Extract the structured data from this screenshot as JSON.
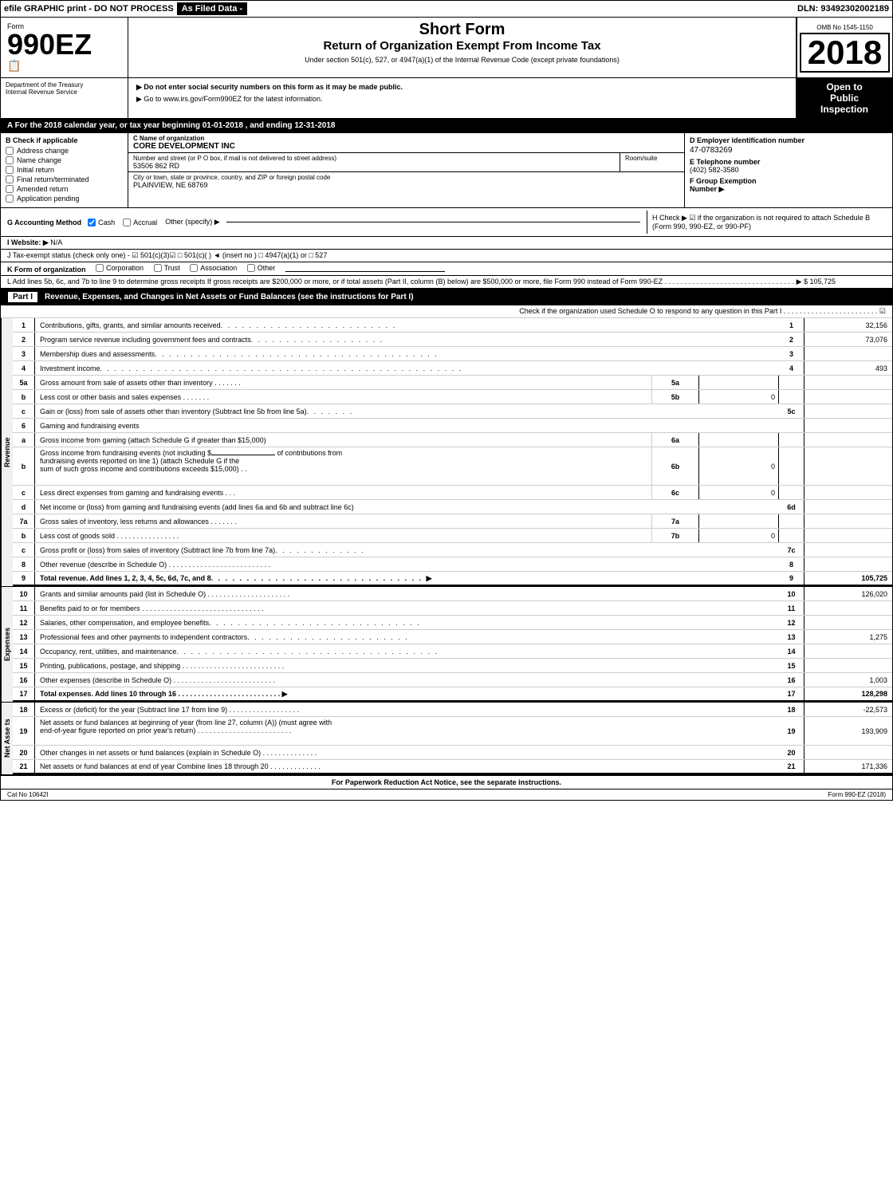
{
  "topbar": {
    "text": "efile GRAPHIC print - DO NOT PROCESS",
    "filed": "As Filed Data -",
    "dln": "DLN: 93492302002189"
  },
  "form": {
    "form_label": "Form",
    "form_number": "990EZ",
    "short_form": "Short Form",
    "return_title": "Return of Organization Exempt From Income Tax",
    "subtitle": "Under section 501(c), 527, or 4947(a)(1) of the Internal Revenue Code (except private foundations)",
    "omb": "OMB No 1545-1150",
    "year": "2018",
    "open_to": "Open to",
    "public": "Public",
    "inspection": "Inspection"
  },
  "notices": {
    "notice1": "▶ Do not enter social security numbers on this form as it may be made public.",
    "notice2": "▶ Go to www.irs.gov/Form990EZ for the latest information."
  },
  "tax_year": {
    "text": "A  For the 2018 calendar year, or tax year beginning 01-01-2018      , and ending 12-31-2018"
  },
  "check_applicable": {
    "label": "B  Check if applicable",
    "items": [
      "Address change",
      "Name change",
      "Initial return",
      "Final return/terminated",
      "Amended return",
      "Application pending"
    ]
  },
  "org": {
    "name_label": "C Name of organization",
    "name": "CORE DEVELOPMENT INC",
    "address_label": "Number and street (or P O box, if mail is not delivered to street address)",
    "address": "53506 862 RD",
    "room_label": "Room/suite",
    "city_label": "City or town, state or province, country, and ZIP or foreign postal code",
    "city": "PLAINVIEW, NE  68769"
  },
  "ein": {
    "label": "D Employer identification number",
    "value": "47-0783269",
    "phone_label": "E Telephone number",
    "phone": "(402) 582-3580",
    "group_label": "F Group Exemption",
    "group_sub": "Number  ▶"
  },
  "accounting": {
    "label": "G Accounting Method",
    "cash": "Cash",
    "accrual": "Accrual",
    "other": "Other (specify) ▶",
    "h_check": "H  Check ▶",
    "h_text": "☑ if the organization is not required to attach Schedule B (Form 990, 990-EZ, or 990-PF)"
  },
  "website": {
    "label": "I Website: ▶",
    "value": "N/A"
  },
  "tax_status": {
    "text": "J Tax-exempt status (check only one) - ☑ 501(c)(3)☑ □ 501(c)(  ) ◄ (insert no ) □ 4947(a)(1) or □ 527"
  },
  "form_org": {
    "label": "K Form of organization",
    "corporation": "Corporation",
    "trust": "Trust",
    "association": "Association",
    "other": "Other"
  },
  "add_lines": {
    "text": "L Add lines 5b, 6c, and 7b to line 9 to determine gross receipts  If gross receipts are $200,000 or more, or if total assets (Part II, column (B) below) are $500,000 or more, file Form 990 instead of Form 990-EZ . . . . . . . . . . . . . . . . . . . . . . . . . . . . . . . . . ▶ $ 105,725"
  },
  "part1": {
    "label": "Part I",
    "title": "Revenue, Expenses, and Changes in Net Assets or Fund Balances (see the instructions for Part I)",
    "schedule_o": "Check if the organization used Schedule O to respond to any question in this Part I . . . . . . . . . . . . . . . . . . . . . . . . ☑",
    "rows": [
      {
        "num": "1",
        "desc": "Contributions, gifts, grants, and similar amounts received . . . . . . . . . . . . . . . . . . . . . . . . . .",
        "main_num": "1",
        "main_val": "32,156",
        "sub_num": "",
        "sub_val": ""
      },
      {
        "num": "2",
        "desc": "Program service revenue including government fees and contracts . . . . . . . . . . . . . . . . . . .",
        "main_num": "2",
        "main_val": "73,076",
        "sub_num": "",
        "sub_val": ""
      },
      {
        "num": "3",
        "desc": "Membership dues and assessments . . . . . . . . . . . . . . . . . . . . . . . . . . . . . . . . . . . . . . . .",
        "main_num": "3",
        "main_val": "",
        "sub_num": "",
        "sub_val": ""
      },
      {
        "num": "4",
        "desc": "Investment income . . . . . . . . . . . . . . . . . . . . . . . . . . . . . . . . . . . . . . . . . . . . . . . . . . . .",
        "main_num": "4",
        "main_val": "493",
        "sub_num": "",
        "sub_val": ""
      },
      {
        "num": "5a",
        "desc": "Gross amount from sale of assets other than inventory  . . . . . . .",
        "main_num": "",
        "main_val": "",
        "sub_num": "5a",
        "sub_val": ""
      },
      {
        "num": "b",
        "desc": "Less  cost or other basis and sales expenses . . . . . . . .",
        "main_num": "",
        "main_val": "",
        "sub_num": "5b",
        "sub_val": "0"
      },
      {
        "num": "c",
        "desc": "Gain or (loss) from sale of assets other than inventory (Subtract line 5b from line 5a) . . . . . . . .",
        "main_num": "5c",
        "main_val": "",
        "sub_num": "",
        "sub_val": ""
      }
    ],
    "gaming_label": "6    Gaming and fundraising events",
    "row6a": {
      "num": "a",
      "desc": "Gross income from gaming (attach Schedule G if greater than $15,000)",
      "sub_num": "6a",
      "sub_val": ""
    },
    "row6b_prefix": "b    Gross income from fundraising events (not including $",
    "row6b_suffix": "of contributions from",
    "row6b_line2": "fundraising events reported on line 1) (attach Schedule G if the",
    "row6b_line3": "sum of such gross income and contributions exceeds $15,000)",
    "row6b": {
      "sub_num": "6b",
      "sub_val": "0"
    },
    "row6c": {
      "num": "c",
      "desc": "Less  direct expenses from gaming and fundraising events   .  .  .",
      "sub_num": "6c",
      "sub_val": "0"
    },
    "row6d": {
      "num": "d",
      "desc": "Net income or (loss) from gaming and fundraising events (add lines 6a and 6b and subtract line 6c)",
      "main_num": "6d",
      "main_val": ""
    },
    "row7a": {
      "num": "7a",
      "desc": "Gross sales of inventory, less returns and allowances . . . . . . . .",
      "sub_num": "7a",
      "sub_val": ""
    },
    "row7b": {
      "num": "b",
      "desc": "Less  cost of goods sold        .  .  .  .  .  .  .  .  .  .  .  .  .  .  .  .",
      "sub_num": "7b",
      "sub_val": "0"
    },
    "row7c": {
      "num": "c",
      "desc": "Gross profit or (loss) from sales of inventory (Subtract line 7b from line 7a) . . . . . . . . . . . . . .",
      "main_num": "7c",
      "main_val": ""
    },
    "row8": {
      "num": "8",
      "desc": "Other revenue (describe in Schedule O)        .  .  .  .  .  .  .  .  .  .  .  .  .  .  .  .  .  .  .  .  .  .  .  .  .  .",
      "main_num": "8",
      "main_val": ""
    },
    "row9": {
      "num": "9",
      "desc": "Total revenue. Add lines 1, 2, 3, 4, 5c, 6d, 7c, and 8 . . . . . . . . . . . . . . . . . . . . . . . . . . . . . ▶",
      "main_num": "9",
      "main_val": "105,725",
      "bold": true
    },
    "row10": {
      "num": "10",
      "desc": "Grants and similar amounts paid (list in Schedule O)         .  .  .  .  .  .  .  .  .  .  .  .  .  .  .  .  .  .  .  .  .",
      "main_num": "10",
      "main_val": "126,020"
    },
    "row11": {
      "num": "11",
      "desc": "Benefits paid to or for members       .  .  .  .  .  .  .  .  .  .  .  .  .  .  .  .  .  .  .  .  .  .  .  .  .  .  .  .  .  .  .",
      "main_num": "11",
      "main_val": ""
    },
    "row12": {
      "num": "12",
      "desc": "Salaries, other compensation, and employee benefits . . . . . . . . . . . . . . . . . . . . . . . . . . . . . .",
      "main_num": "12",
      "main_val": ""
    },
    "row13": {
      "num": "13",
      "desc": "Professional fees and other payments to independent contractors . . . . . . . . . . . . . . . . . . . . . . .",
      "main_num": "13",
      "main_val": "1,275"
    },
    "row14": {
      "num": "14",
      "desc": "Occupancy, rent, utilities, and maintenance . . . . . . . . . . . . . . . . . . . . . . . . . . . . . . . . . . . . .",
      "main_num": "14",
      "main_val": ""
    },
    "row15": {
      "num": "15",
      "desc": "Printing, publications, postage, and shipping        .  .  .  .  .  .  .  .  .  .  .  .  .  .  .  .  .  .  .  .  .  .  .  .  .  .",
      "main_num": "15",
      "main_val": ""
    },
    "row16": {
      "num": "16",
      "desc": "Other expenses (describe in Schedule O)        .  .  .  .  .  .  .  .  .  .  .  .  .  .  .  .  .  .  .  .  .  .  .  .  .  .",
      "main_num": "16",
      "main_val": "1,003"
    },
    "row17": {
      "num": "17",
      "desc": "Total expenses. Add lines 10 through 16      .  .  .  .  .  .  .  .  .  .  .  .  .  .  .  .  .  .  .  .  .  .  .  .  .  . ▶",
      "main_num": "17",
      "main_val": "128,298",
      "bold": true
    },
    "row18": {
      "num": "18",
      "desc": "Excess or (deficit) for the year (Subtract line 17 from line 9)    .  .  .  .  .  .  .  .  .  .  .  .  .  .  .  .  .  .",
      "main_num": "18",
      "main_val": "-22,573"
    },
    "row19": {
      "num": "19",
      "desc": "Net assets or fund balances at beginning of year (from line 27, column (A)) (must agree with end-of-year figure reported on prior year's return)     .  .  .  .  .  .  .  .  .  .  .  .  .  .  .  .  .  .  .  .  .  .  .  .",
      "main_num": "19",
      "main_val": "193,909"
    },
    "row20": {
      "num": "20",
      "desc": "Other changes in net assets or fund balances (explain in Schedule O)   .  .  .  .  .  .  .  .  .  .  .  .  .  .",
      "main_num": "20",
      "main_val": ""
    },
    "row21": {
      "num": "21",
      "desc": "Net assets or fund balances at end of year  Combine lines 18 through 20   .  .  .  .  .  .  .  .  .  .  .  .  .",
      "main_num": "21",
      "main_val": "171,336"
    }
  },
  "footer": {
    "text": "For Paperwork Reduction Act Notice, see the separate instructions.",
    "cat_no": "Cat No 10642I",
    "form": "Form 990-EZ (2018)"
  },
  "sections": {
    "revenue": "Revenue",
    "expenses": "Expenses",
    "net_assets": "Net Asse ts"
  }
}
